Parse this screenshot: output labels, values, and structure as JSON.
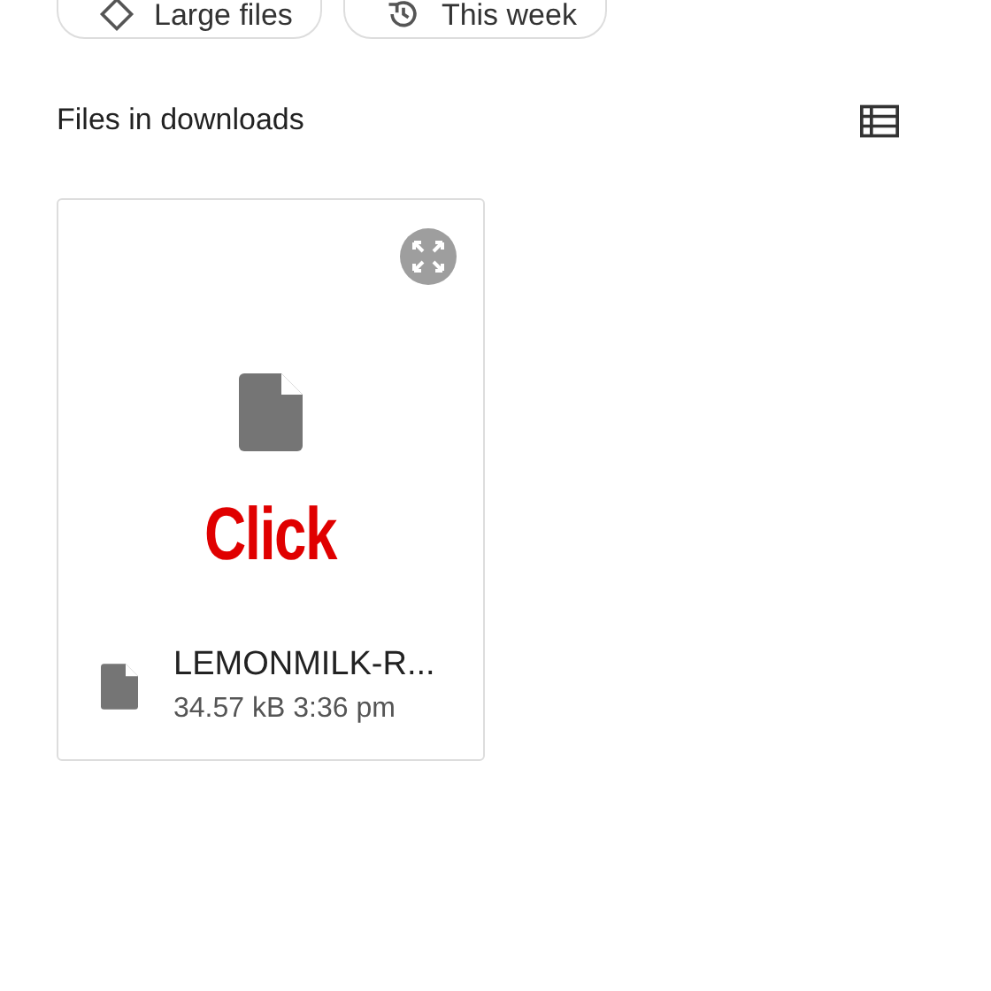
{
  "chips": [
    {
      "label": "Large files",
      "kind": "size"
    },
    {
      "label": "This week",
      "kind": "recent"
    }
  ],
  "section": {
    "title": "Files in downloads"
  },
  "files": [
    {
      "name": "LEMONMILK-R...",
      "meta": "34.57 kB 3:36 pm",
      "overlay": "Click"
    }
  ]
}
